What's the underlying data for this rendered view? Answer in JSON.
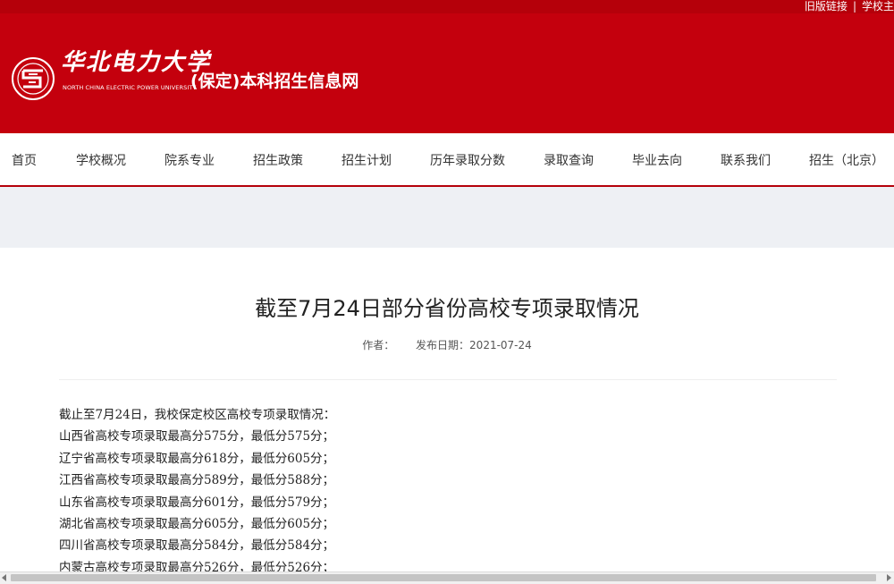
{
  "topbar": {
    "links": [
      "旧版链接",
      "学校主"
    ],
    "separator": "|"
  },
  "header": {
    "brand_cn": "华北电力大学",
    "brand_en": "NORTH CHINA ELECTRIC POWER UNIVERSITY",
    "site_title": "(保定)本科招生信息网",
    "colors": {
      "banner": "#c4000d",
      "topbar": "#b5000a"
    }
  },
  "nav": {
    "items": [
      "首页",
      "学校概况",
      "院系专业",
      "招生政策",
      "招生计划",
      "历年录取分数",
      "录取查询",
      "毕业去向",
      "联系我们",
      "招生（北京）"
    ]
  },
  "article": {
    "title": "截至7月24日部分省份高校专项录取情况",
    "author_label": "作者：",
    "date_label": "发布日期：2021-07-24",
    "paragraphs": [
      "截止至7月24日，我校保定校区高校专项录取情况：",
      "山西省高校专项录取最高分575分，最低分575分；",
      "辽宁省高校专项录取最高分618分，最低分605分；",
      "江西省高校专项录取最高分589分，最低分588分；",
      "山东省高校专项录取最高分601分，最低分579分；",
      "湖北省高校专项录取最高分605分，最低分605分；",
      "四川省高校专项录取最高分584分，最低分584分；",
      "内蒙古高校专项录取最高分526分，最低分526分；"
    ]
  }
}
